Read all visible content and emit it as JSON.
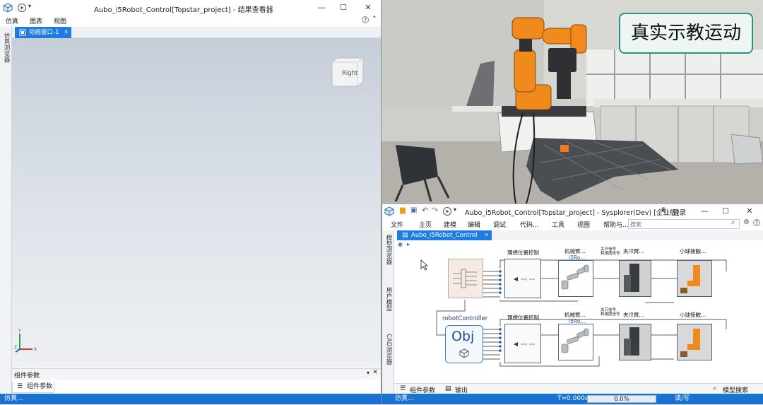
{
  "left_window": {
    "title": "Aubo_i5Robot_Control[Topstar_project] - 结果查看器",
    "menu": [
      "仿真",
      "图表",
      "视图"
    ],
    "side_label": "仿真浏览器",
    "tab_label": "动画窗口-1",
    "viewcube_label": "Right",
    "axis_labels": {
      "x": "X",
      "y": "Y",
      "z": "Z"
    },
    "panel_title": "组件参数",
    "panel_tab": "组件参数",
    "status": "仿真..."
  },
  "camera": {
    "caption": "真实示教运动"
  },
  "right_window": {
    "title": "Aubo_i5Robot_Control[Topstar_project] - Sysplorer(Dev) [企业版]",
    "login": "登录",
    "menu": [
      "文件",
      "主页",
      "建模",
      "编辑",
      "调试",
      "代码...",
      "工具",
      "视图",
      "帮助与..."
    ],
    "search_placeholder": "搜索",
    "tab_label": "Aubo_i5Robot_Control",
    "side_labels": [
      "模型浏览器",
      "用户模型",
      "CAD浏览器"
    ],
    "diagram": {
      "row1": {
        "ideal_ctrl": "理想位置控制",
        "arm_title": "机械臂...",
        "arm_sub": "i5Ro...",
        "joint_note": "关节信号\n和速度信号",
        "gripper": "夹爪臂...",
        "ball": "小球接触..."
      },
      "row2": {
        "controller_name": "robotController",
        "controller_text": "Obj",
        "ideal_ctrl": "理想位置控制",
        "arm_title": "机械臂...",
        "arm_sub": "i5Ro...",
        "joint_note": "关节信号\n和速度信号",
        "gripper": "夹爪臂...",
        "ball": "小球接触..."
      }
    },
    "bottom_tabs": [
      "组件参数",
      "输出"
    ],
    "model_search": "模型搜索",
    "status_left": "仿真...",
    "time_label": "T=0.000s",
    "progress_label": "0.0%",
    "progress_value": 0,
    "rw_mode": "读/写"
  },
  "colors": {
    "accent_blue": "#1e7be0",
    "status_blue": "#1a73d0",
    "robot_orange": "#f08a1c",
    "caption_border": "#2f8f86"
  }
}
